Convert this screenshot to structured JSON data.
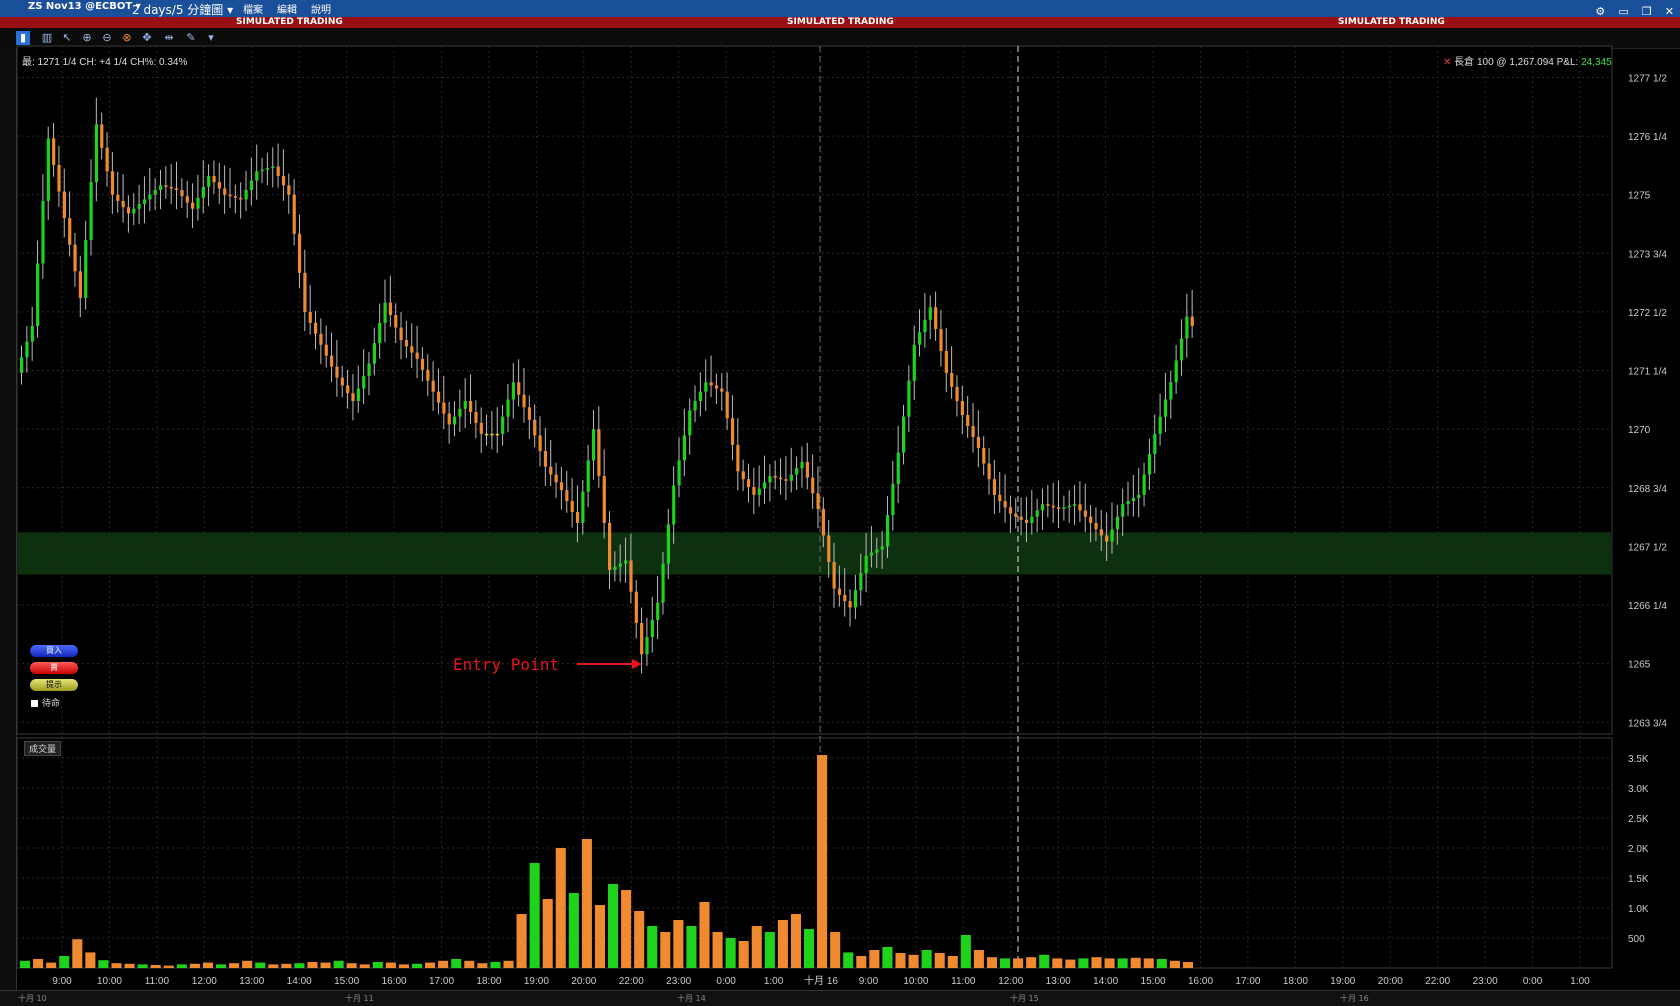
{
  "window": {
    "symbol": "ZS Nov13 @ECBOT",
    "period": "2 days/5 分鐘圖",
    "menus": [
      "檔案",
      "編輯",
      "說明"
    ],
    "banner": "SIMULATED TRADING"
  },
  "info_line": "最: 1271 1/4 CH: +4 1/4 CH%: 0.34%",
  "position_line": "長倉 100 @ 1,267.094 P&L:",
  "pnl_value": "24,345",
  "order_buttons": {
    "buy": "買入",
    "sell": "賣",
    "alert": "提示",
    "pending": "待命"
  },
  "annotation": "Entry Point",
  "volume_title": "成交量",
  "bottom_dates": [
    "十月 10",
    "十月 11",
    "十月 14",
    "十月 15",
    "十月 16"
  ],
  "colors": {
    "up": "#1fd21c",
    "down": "#f08a30",
    "flat": "#e8e000",
    "highlight": "#0f3a12",
    "titlebar": "#1a4f9a",
    "banner": "#9a0f14"
  },
  "chart_data": {
    "type": "candlestick",
    "price_axis": [
      "1277 1/2",
      "1276 1/4",
      "1275",
      "1273 3/4",
      "1272 1/2",
      "1271 1/4",
      "1270",
      "1268 3/4",
      "1267 1/2",
      "1266 1/4",
      "1265",
      "1263 3/4"
    ],
    "price_ylim": [
      1263.5,
      1278
    ],
    "volume_axis": [
      "3.5K",
      "3.0K",
      "2.5K",
      "2.0K",
      "1.5K",
      "1.0K",
      "500"
    ],
    "volume_ylim": [
      0,
      3800
    ],
    "time_labels": [
      "9:00",
      "10:00",
      "11:00",
      "12:00",
      "13:00",
      "14:00",
      "15:00",
      "16:00",
      "17:00",
      "18:00",
      "19:00",
      "20:00",
      "22:00",
      "23:00",
      "0:00",
      "1:00",
      "十月 16",
      "9:00",
      "10:00",
      "11:00",
      "12:00",
      "13:00",
      "14:00",
      "15:00",
      "16:00",
      "17:00",
      "18:00",
      "19:00",
      "20:00",
      "22:00",
      "23:00",
      "0:00",
      "1:00"
    ],
    "highlight_band": [
      1266.9,
      1267.8
    ],
    "series": [
      {
        "segment": "session-1",
        "open": 1271.2,
        "path": [
          1272.2,
          1276.2,
          1274.5,
          1272.8,
          1276.5,
          1275.0,
          1274.6,
          1274.9,
          1275.2,
          1275.1,
          1274.7,
          1275.4,
          1275.0,
          1274.9,
          1275.5,
          1275.6,
          1275.0,
          1272.5,
          1271.8,
          1271.1,
          1270.6,
          1271.4,
          1272.7,
          1271.9,
          1271.5,
          1270.8,
          1270.1,
          1270.6,
          1269.9,
          1269.9,
          1271.0,
          1270.2,
          1269.2,
          1268.7,
          1268.0,
          1270.0,
          1267.0,
          1267.2,
          1265.2,
          1266.3,
          1268.8,
          1270.4,
          1271.0,
          1270.8,
          1269.1,
          1268.6,
          1269.0,
          1268.9,
          1269.3,
          1268.3,
          1266.6,
          1266.2,
          1267.3,
          1267.5,
          1269.5,
          1271.8,
          1272.6,
          1271.2,
          1270.3,
          1269.6,
          1268.6,
          1268.2,
          1268.0,
          1268.4,
          1268.3,
          1268.4,
          1268.0,
          1267.6,
          1268.4,
          1268.6,
          1269.9,
          1271.0,
          1272.4,
          1271.8,
          1271.6
        ]
      }
    ],
    "volume": [
      120,
      150,
      90,
      200,
      480,
      260,
      130,
      80,
      70,
      60,
      50,
      40,
      60,
      70,
      90,
      60,
      80,
      120,
      90,
      60,
      70,
      80,
      100,
      90,
      120,
      80,
      60,
      100,
      90,
      60,
      70,
      90,
      120,
      150,
      120,
      80,
      100,
      120,
      900,
      1750,
      1150,
      2000,
      1250,
      2150,
      1050,
      1400,
      1300,
      950,
      700,
      600,
      800,
      700,
      1100,
      600,
      500,
      450,
      700,
      600,
      800,
      900,
      650,
      3550,
      600,
      260,
      200,
      300,
      350,
      250,
      220,
      300,
      250,
      200,
      550,
      300,
      180,
      160,
      160,
      180,
      220,
      160,
      140,
      160,
      180,
      160,
      160,
      170,
      160,
      150,
      120,
      100
    ]
  }
}
